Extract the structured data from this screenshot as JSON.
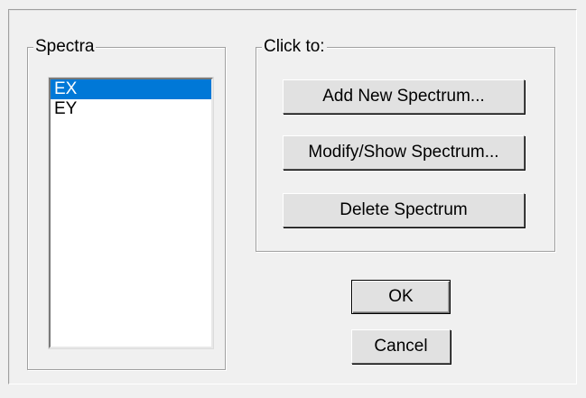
{
  "spectra": {
    "legend": "Spectra",
    "items": [
      {
        "label": "EX",
        "selected": true
      },
      {
        "label": "EY",
        "selected": false
      }
    ]
  },
  "actions": {
    "legend": "Click to:",
    "add_label": "Add New Spectrum...",
    "modify_label": "Modify/Show Spectrum...",
    "delete_label": "Delete Spectrum"
  },
  "footer": {
    "ok_label": "OK",
    "cancel_label": "Cancel"
  },
  "colors": {
    "selection": "#0078d7",
    "dialog_bg": "#f0f0f0",
    "button_face": "#e1e1e1"
  }
}
